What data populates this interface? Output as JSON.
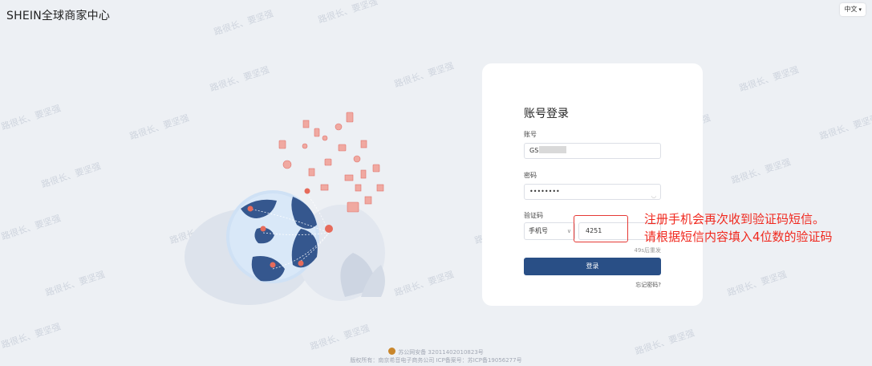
{
  "brand": {
    "title": "SHEIN全球商家中心"
  },
  "language": {
    "label": "中文"
  },
  "watermark": {
    "text": "路很长、要坚强"
  },
  "login": {
    "title": "账号登录",
    "account_label": "账号",
    "account_value": "GS",
    "password_label": "密码",
    "password_value": "••••••••",
    "code_label": "验证码",
    "code_method": "手机号",
    "code_value": "4251",
    "resend": "49s后重发",
    "submit": "登录",
    "forgot": "忘记密码?"
  },
  "annotation": {
    "line1": "注册手机会再次收到验证码短信。",
    "line2": "请根据短信内容填入4位数的验证码",
    "color": "#f0281e"
  },
  "footer": {
    "police": "苏公网安备 32011402010823号",
    "copyright": "版权所有：南京希音电子商务公司  ICP备案号：苏ICP备19056277号"
  },
  "colors": {
    "primary": "#294f86",
    "background": "#edf0f4"
  }
}
